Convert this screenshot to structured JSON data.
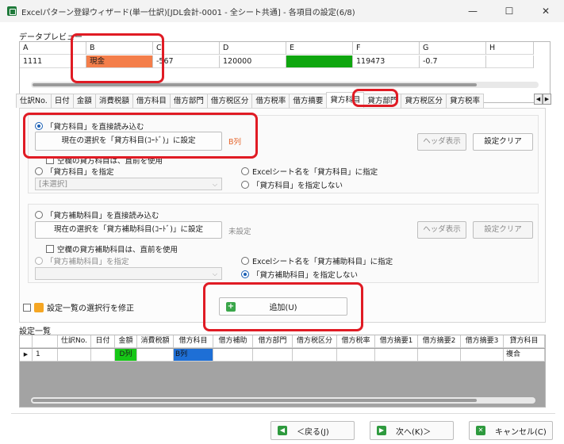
{
  "window": {
    "title": "Excelパターン登録ウィザード(単一仕訳)[JDL会計-0001 - 全シート共通] - 各項目の設定(6/8)",
    "minimize": "—",
    "maximize": "☐",
    "close": "✕"
  },
  "preview": {
    "label": "データプレビュー",
    "columns": [
      "A",
      "B",
      "C",
      "D",
      "E",
      "F",
      "G",
      "H"
    ],
    "row": [
      "1111",
      "現金",
      "-567",
      "120000",
      "",
      "119473",
      "-0.7",
      ""
    ],
    "highlight_b": "#f47e4a",
    "highlight_e": "#0fa60f"
  },
  "tabs": [
    "仕訳No.",
    "日付",
    "金額",
    "消費税額",
    "借方科目",
    "借方部門",
    "借方税区分",
    "借方税率",
    "借方摘要",
    "貸方科目",
    "貸方部門",
    "貸方税区分",
    "貸方税率"
  ],
  "tab_left": "◀",
  "tab_right": "▶",
  "section1": {
    "direct_read": "「貸方科目」を直接読み込む",
    "set_button": "現在の選択を「貸方科目(ｺｰﾄﾞ)」に設定",
    "status": "B列",
    "header_btn": "ヘッダ表示",
    "clear_btn": "設定クリア",
    "blank_check": "空欄の貸方科目は、直前を使用",
    "specify": "「貸方科目」を指定",
    "select_value": "[未選択]",
    "sheetname": "Excelシート名を「貸方科目」に指定",
    "not_specify": "「貸方科目」を指定しない"
  },
  "section2": {
    "direct_read": "「貸方補助科目」を直接読み込む",
    "set_button": "現在の選択を「貸方補助科目(ｺｰﾄﾞ)」に設定",
    "status": "未設定",
    "header_btn": "ヘッダ表示",
    "clear_btn": "設定クリア",
    "blank_check": "空欄の貸方補助科目は、直前を使用",
    "specify": "「貸方補助科目」を指定",
    "select_value": "",
    "sheetname": "Excelシート名を「貸方補助科目」に指定",
    "not_specify": "「貸方補助科目」を指定しない"
  },
  "modify_row": "設定一覧の選択行を修正",
  "add_button": "追加(U)",
  "list": {
    "label": "設定一覧",
    "columns": [
      "",
      "",
      "仕訳No.",
      "日付",
      "金額",
      "消費税額",
      "借方科目",
      "借方補助",
      "借方部門",
      "借方税区分",
      "借方税率",
      "借方摘要1",
      "借方摘要2",
      "借方摘要3",
      "貸方科目"
    ],
    "row": [
      "▶",
      "1",
      "",
      "",
      "D列",
      "",
      "B列",
      "",
      "",
      "",
      "",
      "",
      "",
      "",
      "複合"
    ],
    "green": "#16c716",
    "blue": "#1e6fd6"
  },
  "nav": {
    "back": "＜戻る(J)",
    "next": "次へ(K)＞",
    "cancel": "キャンセル(C)"
  },
  "accent": "#e01b24"
}
